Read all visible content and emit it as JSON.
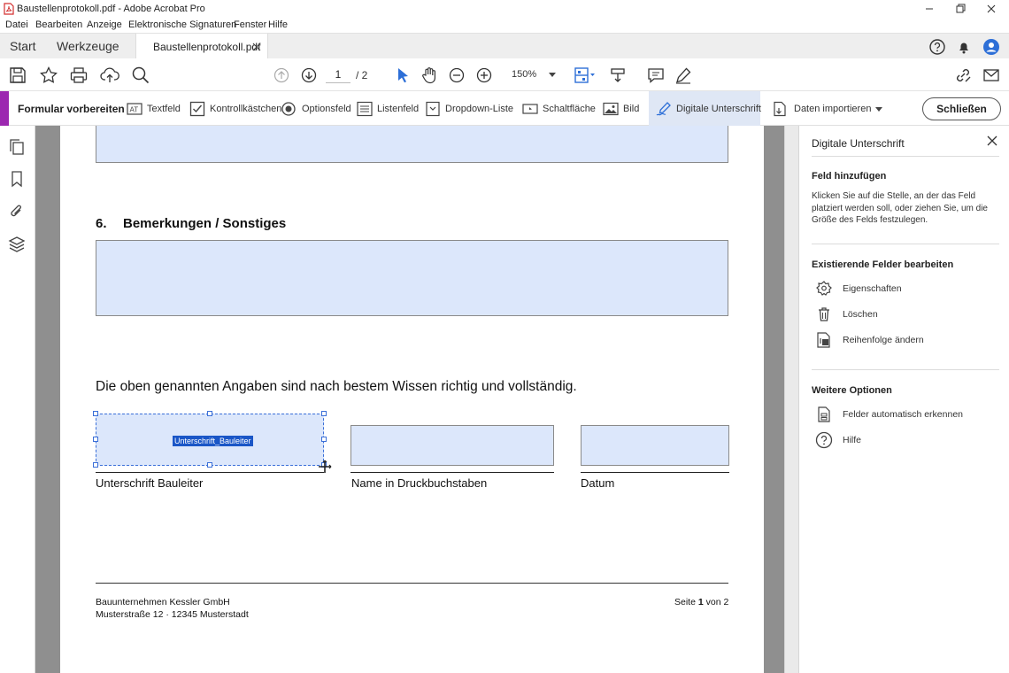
{
  "window": {
    "title": "Baustellenprotokoll.pdf - Adobe Acrobat Pro"
  },
  "menu": [
    "Datei",
    "Bearbeiten",
    "Anzeige",
    "Elektronische Signaturen",
    "Fenster",
    "Hilfe"
  ],
  "tabs": {
    "start": "Start",
    "tools": "Werkzeuge",
    "document": "Baustellenprotokoll.pdf"
  },
  "toolbar": {
    "page_current": "1",
    "page_total": "/ 2",
    "zoom": "150%"
  },
  "form_toolbar": {
    "title": "Formular vorbereiten",
    "items": [
      {
        "label": "Textfeld",
        "icon": "text-field-icon"
      },
      {
        "label": "Kontrollkästchen",
        "icon": "checkbox-icon"
      },
      {
        "label": "Optionsfeld",
        "icon": "radio-button-icon"
      },
      {
        "label": "Listenfeld",
        "icon": "list-box-icon"
      },
      {
        "label": "Dropdown-Liste",
        "icon": "dropdown-list-icon"
      },
      {
        "label": "Schaltfläche",
        "icon": "button-field-icon"
      },
      {
        "label": "Bild",
        "icon": "image-field-icon"
      },
      {
        "label": "Digitale Unterschrift",
        "icon": "digital-signature-icon",
        "active": true
      }
    ],
    "import": "Daten importieren",
    "close": "Schließen"
  },
  "document": {
    "section_number": "6.",
    "section_title": "Bemerkungen / Sonstiges",
    "declaration": "Die oben genannten Angaben sind nach bestem Wissen richtig und vollständig.",
    "selected_field_name": "Unterschrift_Bauleiter",
    "signature_labels": [
      "Unterschrift Bauleiter",
      "Name in Druckbuchstaben",
      "Datum"
    ],
    "footer_company": "Bauunternehmen Kessler GmbH",
    "footer_address": "Musterstraße 12 · 12345 Musterstadt",
    "footer_page_prefix": "Seite ",
    "footer_page_num": "1",
    "footer_page_suffix": " von 2"
  },
  "panel": {
    "title": "Digitale Unterschrift",
    "add_field_heading": "Feld hinzufügen",
    "add_field_desc": "Klicken Sie auf die Stelle, an der das Feld platziert werden soll, oder ziehen Sie, um die Größe des Felds festzulegen.",
    "edit_heading": "Existierende Felder bearbeiten",
    "edit_items": [
      "Eigenschaften",
      "Löschen",
      "Reihenfolge ändern"
    ],
    "more_heading": "Weitere Optionen",
    "more_items": [
      "Felder automatisch erkennen",
      "Hilfe"
    ]
  },
  "colors": {
    "accent": "#9c27b0",
    "field_fill": "#dce7fb",
    "selection": "#1a56c7"
  }
}
